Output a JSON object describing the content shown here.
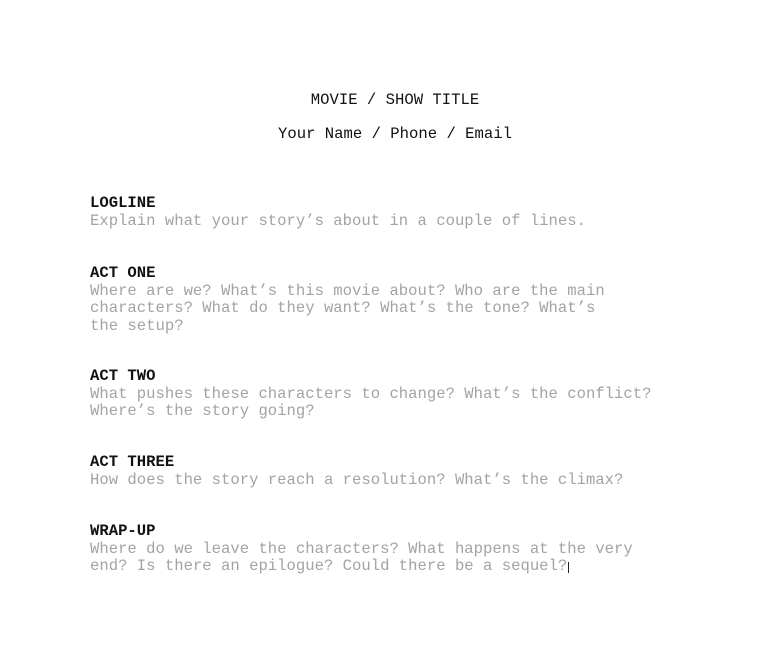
{
  "document": {
    "title": "MOVIE / SHOW TITLE",
    "byline": "Your Name / Phone / Email",
    "sections": [
      {
        "heading": "LOGLINE",
        "lines": [
          "Explain what your story’s about in a couple of lines."
        ]
      },
      {
        "heading": "ACT ONE",
        "lines": [
          "Where are we? What’s this movie about? Who are the main",
          "characters? What do they want? What’s the tone? What’s",
          "the setup?"
        ]
      },
      {
        "heading": "ACT TWO",
        "lines": [
          "What pushes these characters to change? What’s the conflict?",
          "Where’s the story going?"
        ]
      },
      {
        "heading": "ACT THREE",
        "lines": [
          "How does the story reach a resolution? What’s the climax?"
        ]
      },
      {
        "heading": "WRAP-UP",
        "lines": [
          "Where do we leave the characters? What happens at the very",
          "end? Is there an epilogue? Could there be a sequel?"
        ]
      }
    ]
  },
  "colors": {
    "heading_text": "#111111",
    "prompt_text": "#a3a3a3",
    "background": "#ffffff"
  }
}
